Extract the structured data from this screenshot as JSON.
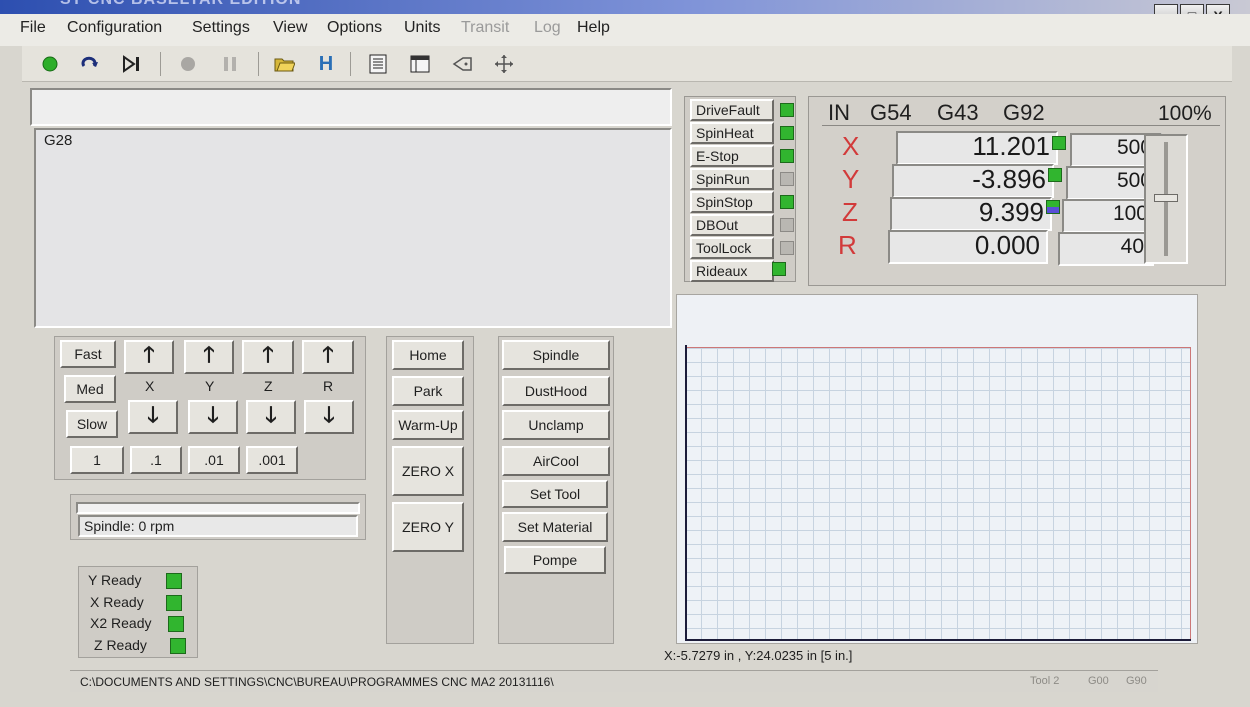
{
  "window": {
    "title": "ST CNC BASELYAR EDITION",
    "controls": [
      "_",
      "□",
      "X"
    ]
  },
  "menu": [
    "File",
    "Configuration",
    "Settings",
    "View",
    "Options",
    "Units",
    "Transit",
    "Log",
    "Help"
  ],
  "toolbar_icons": [
    "run-icon",
    "redo-icon",
    "step-icon",
    "stop-icon",
    "pause-icon",
    "open-folder-icon",
    "home-icon",
    "listing-icon",
    "window-icon",
    "tool-shape-icon",
    "move-icon"
  ],
  "mdi": {
    "value": ""
  },
  "gcode": {
    "lines": [
      "G28"
    ]
  },
  "signals": [
    {
      "label": "DriveFault",
      "state": "on"
    },
    {
      "label": "SpinHeat",
      "state": "on"
    },
    {
      "label": "E-Stop",
      "state": "on"
    },
    {
      "label": "SpinRun",
      "state": "off"
    },
    {
      "label": "SpinStop",
      "state": "on"
    },
    {
      "label": "DBOut",
      "state": "off"
    },
    {
      "label": "ToolLock",
      "state": "off"
    },
    {
      "label": "Rideaux",
      "state": "on"
    }
  ],
  "dro": {
    "modes": [
      "IN",
      "G54",
      "G43",
      "G92"
    ],
    "override": "100%",
    "axes": [
      {
        "label": "X",
        "value": "11.201",
        "feed": "500"
      },
      {
        "label": "Y",
        "value": "-3.896",
        "feed": "500"
      },
      {
        "label": "Z",
        "value": "9.399",
        "feed": "100"
      },
      {
        "label": "R",
        "value": "0.000",
        "feed": "40"
      }
    ]
  },
  "jog": {
    "speeds": [
      "Fast",
      "Med",
      "Slow"
    ],
    "axes": [
      "X",
      "Y",
      "Z",
      "R"
    ],
    "steps": [
      "1",
      ".1",
      ".01",
      ".001"
    ]
  },
  "spindle": {
    "status": "Spindle: 0 rpm",
    "load": 0
  },
  "ready": [
    {
      "label": "Y Ready",
      "state": "on"
    },
    {
      "label": "X Ready",
      "state": "on"
    },
    {
      "label": "X2 Ready",
      "state": "on"
    },
    {
      "label": "Z Ready",
      "state": "on"
    }
  ],
  "nav_buttons": [
    "Home",
    "Park",
    "Warm-Up",
    "ZERO X",
    "ZERO Y"
  ],
  "aux_buttons": [
    "Spindle",
    "DustHood",
    "Unclamp",
    "AirCool",
    "Set Tool",
    "Set Material",
    "Pompe"
  ],
  "preview": {
    "coords": "X:-5.7279 in , Y:24.0235 in [5 in.]"
  },
  "statusbar": {
    "path": "C:\\DOCUMENTS AND SETTINGS\\CNC\\BUREAU\\PROGRAMMES CNC MA2 20131116\\",
    "tool": "Tool 2",
    "g1": "G00",
    "g2": "G90"
  }
}
